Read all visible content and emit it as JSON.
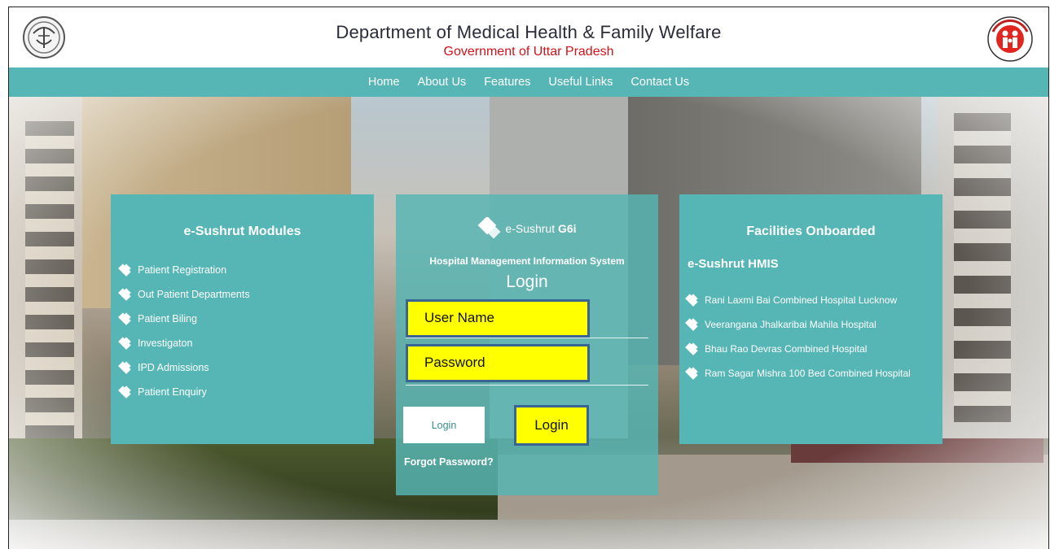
{
  "header": {
    "title": "Department of Medical Health & Family Welfare",
    "subtitle": "Government of Uttar Pradesh",
    "left_emblem": "up-state-emblem-icon",
    "right_emblem": "national-health-mission-logo-icon"
  },
  "nav": {
    "items": [
      "Home",
      "About Us",
      "Features",
      "Useful Links",
      "Contact Us"
    ]
  },
  "modules": {
    "title": "e-Sushrut Modules",
    "items": [
      "Patient Registration",
      "Out Patient Departments",
      "Patient Biling",
      "Investigaton",
      "IPD Admissions",
      "Patient Enquiry"
    ]
  },
  "login": {
    "logo_text_pre": "e-Sushrut ",
    "logo_text_bold": "G6i",
    "system_name": "Hospital Management Information System",
    "heading": "Login",
    "username_placeholder": "User Name",
    "password_placeholder": "Password",
    "login_button_white": "Login",
    "login_button_yellow": "Login",
    "forgot_password": "Forgot Password?"
  },
  "facilities": {
    "title": "Facilities Onboarded",
    "subtitle": "e-Sushrut HMIS",
    "items": [
      "Rani Laxmi Bai Combined Hospital Lucknow",
      "Veerangana Jhalkaribai Mahila Hospital",
      "Bhau Rao Devras Combined Hospital",
      "Ram Sagar Mishra 100 Bed Combined Hospital"
    ]
  },
  "colors": {
    "teal": "#56b6b5",
    "yellow": "#ffff00",
    "field_border": "#3a6592",
    "subtitle_red": "#d0121b"
  }
}
